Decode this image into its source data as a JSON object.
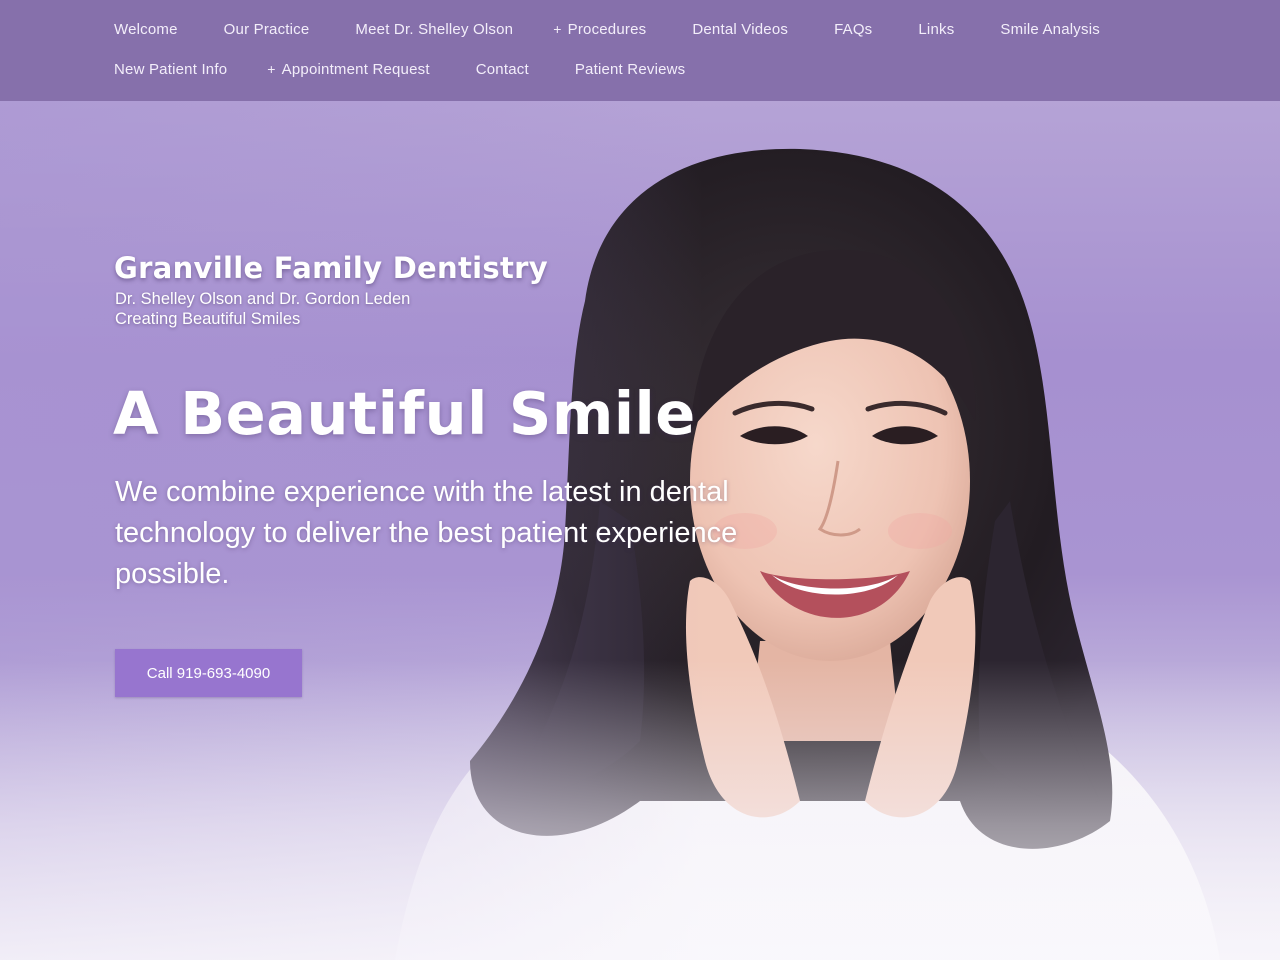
{
  "nav": {
    "row1": [
      {
        "label": "Welcome",
        "plus": ""
      },
      {
        "label": "Our Practice",
        "plus": ""
      },
      {
        "label": "Meet Dr. Shelley Olson",
        "plus": ""
      },
      {
        "label": "Procedures",
        "plus": "+"
      },
      {
        "label": "Dental Videos",
        "plus": ""
      },
      {
        "label": "FAQs",
        "plus": ""
      },
      {
        "label": "Links",
        "plus": ""
      },
      {
        "label": "Smile Analysis",
        "plus": ""
      }
    ],
    "row2": [
      {
        "label": "New Patient Info",
        "plus": ""
      },
      {
        "label": "Appointment Request",
        "plus": "+"
      },
      {
        "label": "Contact",
        "plus": ""
      },
      {
        "label": "Patient Reviews",
        "plus": ""
      }
    ]
  },
  "brand": {
    "title": "Granville Family Dentistry",
    "doctors": "Dr. Shelley Olson and Dr. Gordon Leden",
    "tagline": "Creating Beautiful Smiles"
  },
  "hero": {
    "headline": "A Beautiful Smile",
    "subhead": "We combine experience with the latest in dental technology to deliver the best patient experience possible.",
    "cta_label": "Call 919-693-4090"
  },
  "colors": {
    "nav_bg": "#8670ab",
    "hero_purple": "#a690d0",
    "button": "#9775cf"
  }
}
